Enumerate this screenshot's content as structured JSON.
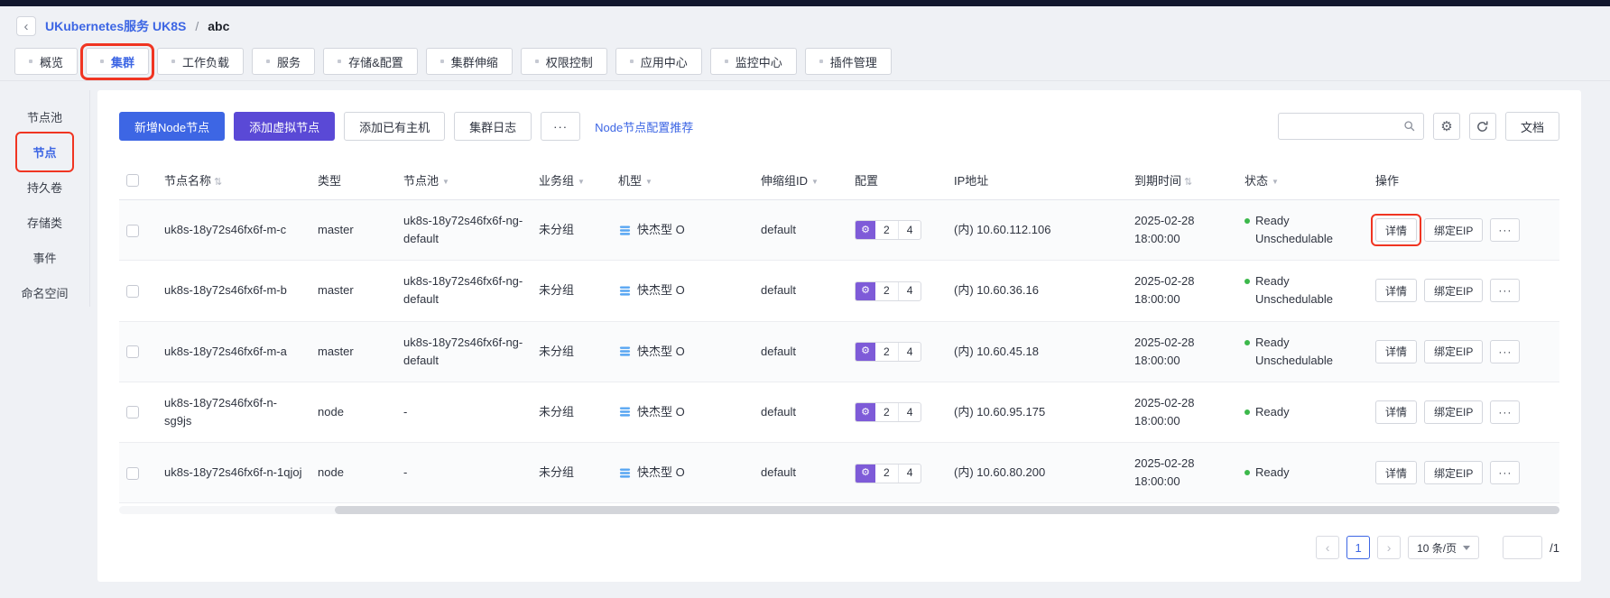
{
  "breadcrumb": {
    "back_icon": "‹",
    "parent": "UKubernetes服务 UK8S",
    "separator": "/",
    "current": "abc"
  },
  "tabs": [
    "概览",
    "集群",
    "工作负载",
    "服务",
    "存储&配置",
    "集群伸缩",
    "权限控制",
    "应用中心",
    "监控中心",
    "插件管理"
  ],
  "active_tab": "集群",
  "sidebar": [
    "节点池",
    "节点",
    "持久卷",
    "存储类",
    "事件",
    "命名空间"
  ],
  "active_sidebar": "节点",
  "toolbar": {
    "add_node_button": "新增Node节点",
    "add_virtual_button": "添加虚拟节点",
    "add_existing_button": "添加已有主机",
    "cluster_log_button": "集群日志",
    "more_button": "···",
    "recommend_link": "Node节点配置推荐",
    "search_value": "",
    "doc_button": "文档"
  },
  "icons": {
    "sort": "⇅",
    "filter": "▼",
    "gear": "⚙"
  },
  "table": {
    "headers": [
      "节点名称",
      "类型",
      "节点池",
      "业务组",
      "机型",
      "伸缩组ID",
      "配置",
      "IP地址",
      "到期时间",
      "状态",
      "操作"
    ],
    "action_labels": {
      "detail": "详情",
      "bind_eip": "绑定EIP",
      "more": "···"
    },
    "rows": [
      {
        "name": "uk8s-18y72s46fx6f-m-c",
        "type": "master",
        "pool": "uk8s-18y72s46fx6f-ng-default",
        "biz_group": "未分组",
        "machine": "快杰型 O",
        "scale_group": "default",
        "cpu": "2",
        "mem": "4",
        "ip": "(内) 10.60.112.106",
        "expire_date": "2025-02-28",
        "expire_time": "18:00:00",
        "status": "Ready",
        "status_extra": "Unschedulable"
      },
      {
        "name": "uk8s-18y72s46fx6f-m-b",
        "type": "master",
        "pool": "uk8s-18y72s46fx6f-ng-default",
        "biz_group": "未分组",
        "machine": "快杰型 O",
        "scale_group": "default",
        "cpu": "2",
        "mem": "4",
        "ip": "(内) 10.60.36.16",
        "expire_date": "2025-02-28",
        "expire_time": "18:00:00",
        "status": "Ready",
        "status_extra": "Unschedulable"
      },
      {
        "name": "uk8s-18y72s46fx6f-m-a",
        "type": "master",
        "pool": "uk8s-18y72s46fx6f-ng-default",
        "biz_group": "未分组",
        "machine": "快杰型 O",
        "scale_group": "default",
        "cpu": "2",
        "mem": "4",
        "ip": "(内) 10.60.45.18",
        "expire_date": "2025-02-28",
        "expire_time": "18:00:00",
        "status": "Ready",
        "status_extra": "Unschedulable"
      },
      {
        "name": "uk8s-18y72s46fx6f-n-sg9js",
        "type": "node",
        "pool": "-",
        "biz_group": "未分组",
        "machine": "快杰型 O",
        "scale_group": "default",
        "cpu": "2",
        "mem": "4",
        "ip": "(内) 10.60.95.175",
        "expire_date": "2025-02-28",
        "expire_time": "18:00:00",
        "status": "Ready",
        "status_extra": ""
      },
      {
        "name": "uk8s-18y72s46fx6f-n-1qjoj",
        "type": "node",
        "pool": "-",
        "biz_group": "未分组",
        "machine": "快杰型 O",
        "scale_group": "default",
        "cpu": "2",
        "mem": "4",
        "ip": "(内) 10.60.80.200",
        "expire_date": "2025-02-28",
        "expire_time": "18:00:00",
        "status": "Ready",
        "status_extra": ""
      }
    ]
  },
  "pagination": {
    "prev": "‹",
    "current": "1",
    "next": "›",
    "page_size": "10 条/页",
    "jump_suffix": "/1"
  },
  "colors": {
    "primary_blue": "#3d66e4",
    "virtual_node_purple": "#5a49d6",
    "config_badge_purple": "#7e5bd8",
    "status_green": "#3cb84b",
    "annotation_red": "#f03522",
    "topbar_navy": "#12172e"
  }
}
